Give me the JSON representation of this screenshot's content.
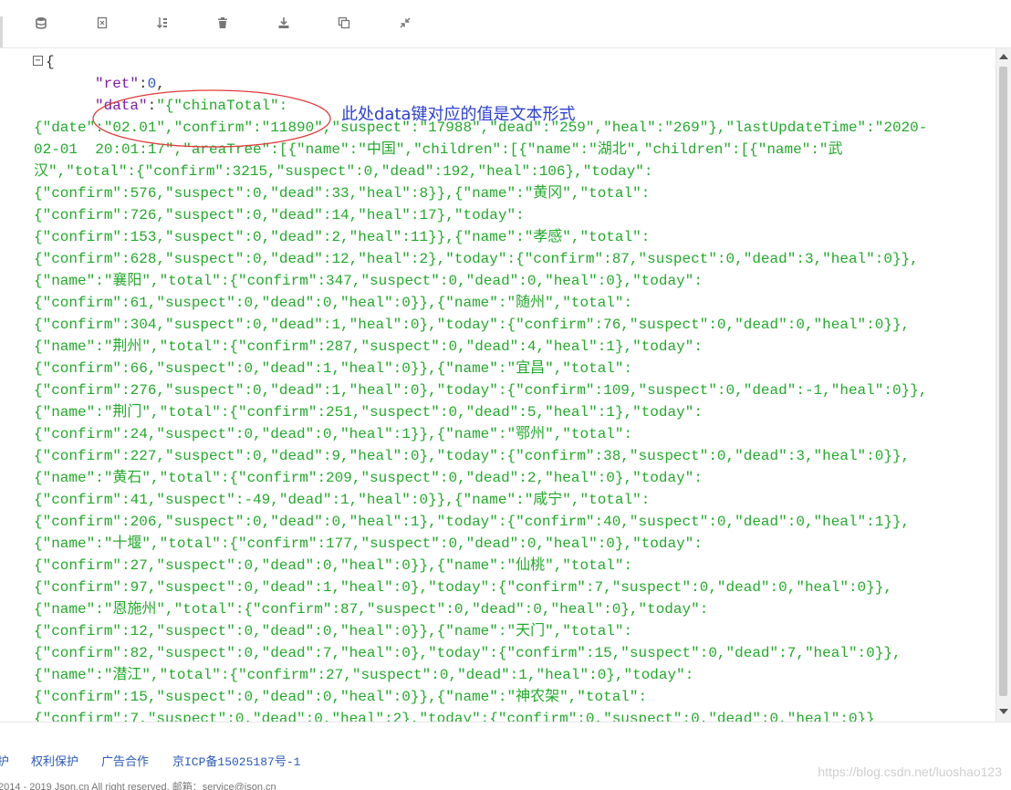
{
  "toolbar": {
    "buttons": [
      {
        "name": "database-icon"
      },
      {
        "name": "file-export-icon"
      },
      {
        "name": "sort-icon"
      },
      {
        "name": "trash-icon"
      },
      {
        "name": "download-icon"
      },
      {
        "name": "copy-icon"
      },
      {
        "name": "compress-icon"
      }
    ]
  },
  "editor": {
    "fold_symbol": "−",
    "open_brace": "{",
    "ret_key": "\"ret\"",
    "ret_value": "0",
    "data_key": "\"data\"",
    "data_value_start": "\"{\"chinaTotal\":",
    "lines": [
      "{\"date\":\"02.01\",\"confirm\":\"11890\",\"suspect\":\"17988\",\"dead\":\"259\",\"heal\":\"269\"},\"lastUpdateTime\":\"2020-",
      "02-01  20:01:17\",\"areaTree\":[{\"name\":\"中国\",\"children\":[{\"name\":\"湖北\",\"children\":[{\"name\":\"武",
      "汉\",\"total\":{\"confirm\":3215,\"suspect\":0,\"dead\":192,\"heal\":106},\"today\":",
      "{\"confirm\":576,\"suspect\":0,\"dead\":33,\"heal\":8}},{\"name\":\"黄冈\",\"total\":",
      "{\"confirm\":726,\"suspect\":0,\"dead\":14,\"heal\":17},\"today\":",
      "{\"confirm\":153,\"suspect\":0,\"dead\":2,\"heal\":11}},{\"name\":\"孝感\",\"total\":",
      "{\"confirm\":628,\"suspect\":0,\"dead\":12,\"heal\":2},\"today\":{\"confirm\":87,\"suspect\":0,\"dead\":3,\"heal\":0}},",
      "{\"name\":\"襄阳\",\"total\":{\"confirm\":347,\"suspect\":0,\"dead\":0,\"heal\":0},\"today\":",
      "{\"confirm\":61,\"suspect\":0,\"dead\":0,\"heal\":0}},{\"name\":\"随州\",\"total\":",
      "{\"confirm\":304,\"suspect\":0,\"dead\":1,\"heal\":0},\"today\":{\"confirm\":76,\"suspect\":0,\"dead\":0,\"heal\":0}},",
      "{\"name\":\"荆州\",\"total\":{\"confirm\":287,\"suspect\":0,\"dead\":4,\"heal\":1},\"today\":",
      "{\"confirm\":66,\"suspect\":0,\"dead\":1,\"heal\":0}},{\"name\":\"宜昌\",\"total\":",
      "{\"confirm\":276,\"suspect\":0,\"dead\":1,\"heal\":0},\"today\":{\"confirm\":109,\"suspect\":0,\"dead\":-1,\"heal\":0}},",
      "{\"name\":\"荆门\",\"total\":{\"confirm\":251,\"suspect\":0,\"dead\":5,\"heal\":1},\"today\":",
      "{\"confirm\":24,\"suspect\":0,\"dead\":0,\"heal\":1}},{\"name\":\"鄂州\",\"total\":",
      "{\"confirm\":227,\"suspect\":0,\"dead\":9,\"heal\":0},\"today\":{\"confirm\":38,\"suspect\":0,\"dead\":3,\"heal\":0}},",
      "{\"name\":\"黄石\",\"total\":{\"confirm\":209,\"suspect\":0,\"dead\":2,\"heal\":0},\"today\":",
      "{\"confirm\":41,\"suspect\":-49,\"dead\":1,\"heal\":0}},{\"name\":\"咸宁\",\"total\":",
      "{\"confirm\":206,\"suspect\":0,\"dead\":0,\"heal\":1},\"today\":{\"confirm\":40,\"suspect\":0,\"dead\":0,\"heal\":1}},",
      "{\"name\":\"十堰\",\"total\":{\"confirm\":177,\"suspect\":0,\"dead\":0,\"heal\":0},\"today\":",
      "{\"confirm\":27,\"suspect\":0,\"dead\":0,\"heal\":0}},{\"name\":\"仙桃\",\"total\":",
      "{\"confirm\":97,\"suspect\":0,\"dead\":1,\"heal\":0},\"today\":{\"confirm\":7,\"suspect\":0,\"dead\":0,\"heal\":0}},",
      "{\"name\":\"恩施州\",\"total\":{\"confirm\":87,\"suspect\":0,\"dead\":0,\"heal\":0},\"today\":",
      "{\"confirm\":12,\"suspect\":0,\"dead\":0,\"heal\":0}},{\"name\":\"天门\",\"total\":",
      "{\"confirm\":82,\"suspect\":0,\"dead\":7,\"heal\":0},\"today\":{\"confirm\":15,\"suspect\":0,\"dead\":7,\"heal\":0}},",
      "{\"name\":\"潜江\",\"total\":{\"confirm\":27,\"suspect\":0,\"dead\":1,\"heal\":0},\"today\":",
      "{\"confirm\":15,\"suspect\":0,\"dead\":0,\"heal\":0}},{\"name\":\"神农架\",\"total\":",
      "{\"confirm\":7,\"suspect\":0,\"dead\":0,\"heal\":2},\"today\":{\"confirm\":0,\"suspect\":0,\"dead\":0,\"heal\":0}}"
    ],
    "annotation": "此处data键对应的值是文本形式"
  },
  "footer": {
    "links": [
      "护",
      "权利保护",
      "广告合作",
      "京ICP备15025187号-1"
    ],
    "copyright": "2014 - 2019 Json.cn All right reserved. 邮箱：service@json.cn",
    "watermark": "https://blog.csdn.net/luoshao123"
  },
  "colors": {
    "string": "#22aa2a",
    "key": "#7f1aa8",
    "number": "#2a52c8",
    "annotation": "#2b3fd6",
    "link": "#2a5ab8"
  }
}
